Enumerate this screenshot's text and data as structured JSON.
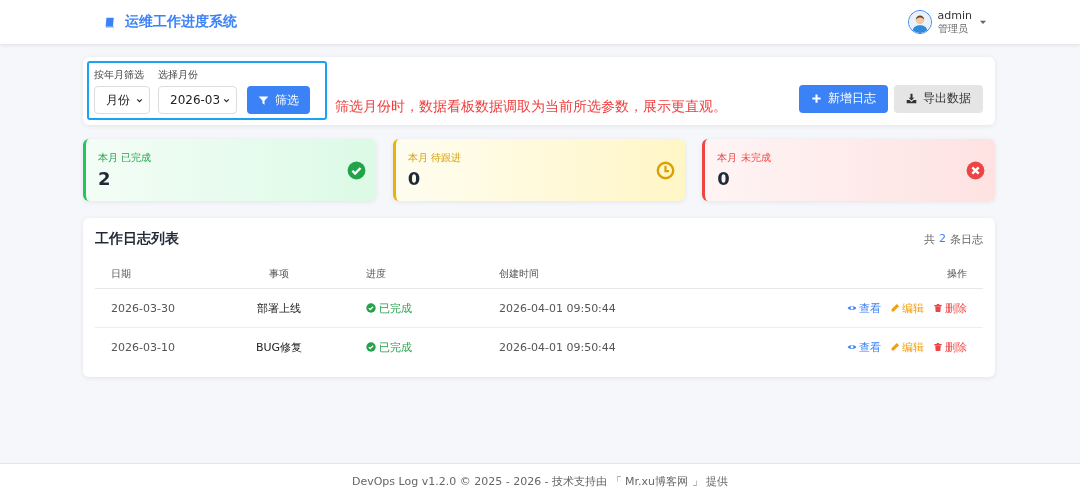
{
  "header": {
    "title": "运维工作进度系统",
    "user": {
      "name": "admin",
      "role": "管理员"
    }
  },
  "filter": {
    "fields": [
      {
        "label": "按年月筛选",
        "value": "月份"
      },
      {
        "label": "选择月份",
        "value": "2026-03"
      }
    ],
    "button": "筛选",
    "note": "筛选月份时，数据看板数据调取为当前所选参数，展示更直观。"
  },
  "actions": [
    {
      "kind": "add",
      "label": "新增日志"
    },
    {
      "kind": "export",
      "label": "导出数据"
    }
  ],
  "stats": [
    {
      "kind": "done",
      "label": "本月 已完成",
      "value": "2"
    },
    {
      "kind": "pending",
      "label": "本月 待跟进",
      "value": "0"
    },
    {
      "kind": "undone",
      "label": "本月 未完成",
      "value": "0"
    }
  ],
  "table": {
    "title": "工作日志列表",
    "summary": {
      "prefix": "共",
      "count": "2",
      "suffix": "条日志"
    },
    "columns": [
      "日期",
      "事项",
      "进度",
      "创建时间",
      "操作"
    ],
    "rows": [
      {
        "date": "2026-03-30",
        "item": "部署上线",
        "status": {
          "kind": "done",
          "label": "已完成"
        },
        "created": "2026-04-01 09:50:44",
        "actions": [
          {
            "kind": "view",
            "label": "查看"
          },
          {
            "kind": "edit",
            "label": "编辑"
          },
          {
            "kind": "delete",
            "label": "删除"
          }
        ]
      },
      {
        "date": "2026-03-10",
        "item": "BUG修复",
        "status": {
          "kind": "done",
          "label": "已完成"
        },
        "created": "2026-04-01 09:50:44",
        "actions": [
          {
            "kind": "view",
            "label": "查看"
          },
          {
            "kind": "edit",
            "label": "编辑"
          },
          {
            "kind": "delete",
            "label": "删除"
          }
        ]
      }
    ]
  },
  "footer": "DevOps Log v1.2.0 © 2025 - 2026 - 技术支持由 「 Mr.xu博客网 」 提供"
}
